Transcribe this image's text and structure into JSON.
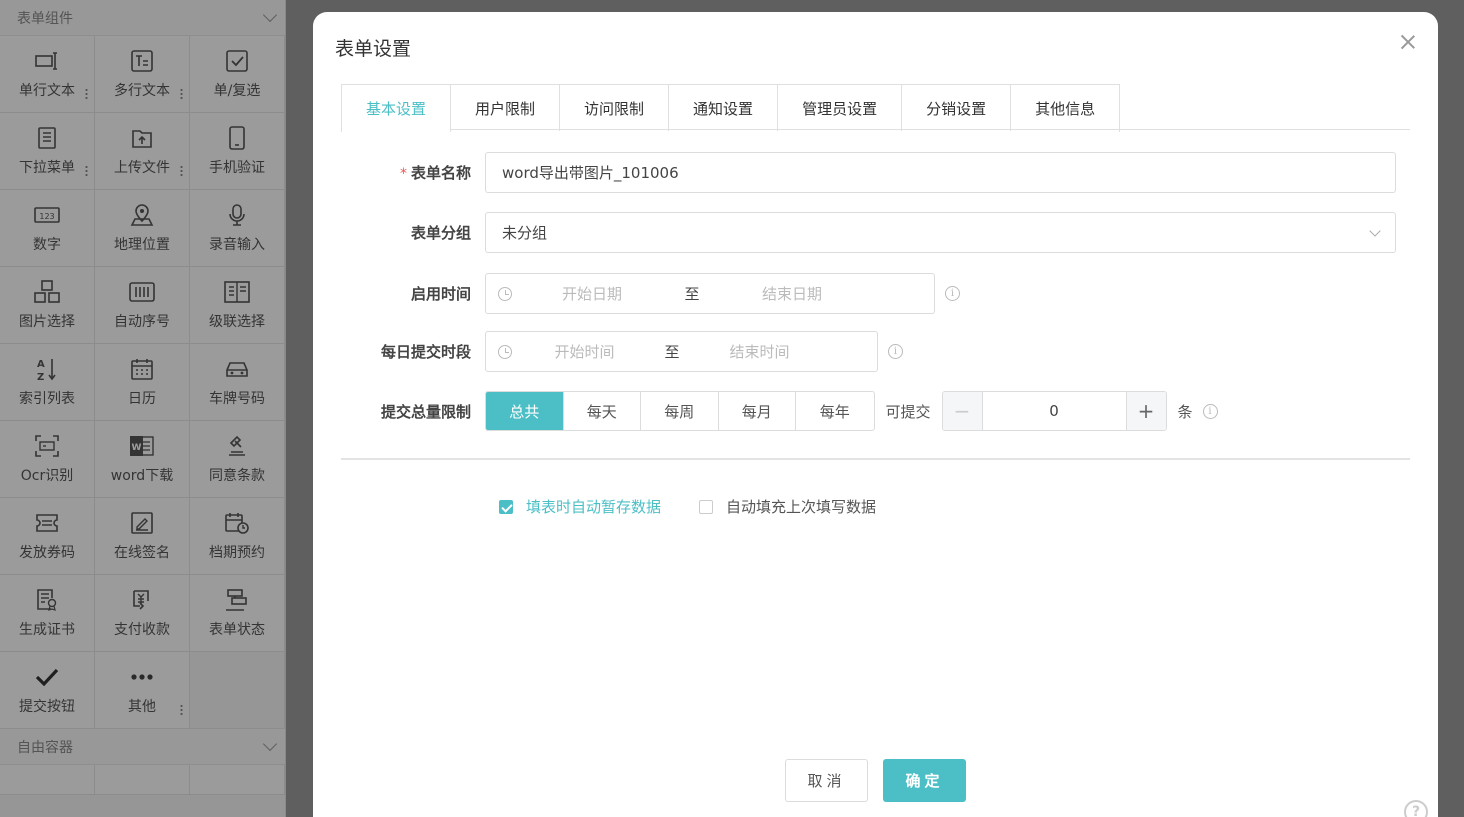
{
  "sidebar": {
    "section1": "表单组件",
    "section2": "自由容器",
    "items": [
      {
        "label": "单行文本",
        "icon": "single-line-text-icon"
      },
      {
        "label": "多行文本",
        "icon": "multi-line-text-icon"
      },
      {
        "label": "单/复选",
        "icon": "checkbox-icon"
      },
      {
        "label": "下拉菜单",
        "icon": "dropdown-icon"
      },
      {
        "label": "上传文件",
        "icon": "upload-file-icon"
      },
      {
        "label": "手机验证",
        "icon": "phone-icon"
      },
      {
        "label": "数字",
        "icon": "number-icon"
      },
      {
        "label": "地理位置",
        "icon": "location-icon"
      },
      {
        "label": "录音输入",
        "icon": "microphone-icon"
      },
      {
        "label": "图片选择",
        "icon": "image-select-icon"
      },
      {
        "label": "自动序号",
        "icon": "auto-number-icon"
      },
      {
        "label": "级联选择",
        "icon": "cascade-icon"
      },
      {
        "label": "索引列表",
        "icon": "sort-az-icon"
      },
      {
        "label": "日历",
        "icon": "calendar-icon"
      },
      {
        "label": "车牌号码",
        "icon": "car-icon"
      },
      {
        "label": "Ocr识别",
        "icon": "ocr-icon"
      },
      {
        "label": "word下载",
        "icon": "word-icon"
      },
      {
        "label": "同意条款",
        "icon": "gavel-icon"
      },
      {
        "label": "发放券码",
        "icon": "coupon-icon"
      },
      {
        "label": "在线签名",
        "icon": "signature-icon"
      },
      {
        "label": "档期预约",
        "icon": "schedule-icon"
      },
      {
        "label": "生成证书",
        "icon": "certificate-icon"
      },
      {
        "label": "支付收款",
        "icon": "payment-icon"
      },
      {
        "label": "表单状态",
        "icon": "form-status-icon"
      },
      {
        "label": "提交按钮",
        "icon": "check-icon"
      },
      {
        "label": "其他",
        "icon": "more-icon"
      }
    ]
  },
  "modal": {
    "title": "表单设置",
    "tabs": [
      "基本设置",
      "用户限制",
      "访问限制",
      "通知设置",
      "管理员设置",
      "分销设置",
      "其他信息"
    ],
    "fields": {
      "name_label": "表单名称",
      "name_required": "*",
      "name_value": "word导出带图片_101006",
      "group_label": "表单分组",
      "group_value": "未分组",
      "enable_label": "启用时间",
      "enable_start": "开始日期",
      "enable_sep": "至",
      "enable_end": "结束日期",
      "daily_label": "每日提交时段",
      "daily_start": "开始时间",
      "daily_sep": "至",
      "daily_end": "结束时间",
      "limit_label": "提交总量限制",
      "limit_options": [
        "总共",
        "每天",
        "每周",
        "每月",
        "每年"
      ],
      "limit_can": "可提交",
      "limit_value": "0",
      "limit_unit": "条"
    },
    "checks": [
      {
        "label": "填表时自动暂存数据",
        "checked": true
      },
      {
        "label": "自动填充上次填写数据",
        "checked": false
      }
    ],
    "cancel": "取消",
    "ok": "确定"
  },
  "accent_color": "#4cbfc6"
}
